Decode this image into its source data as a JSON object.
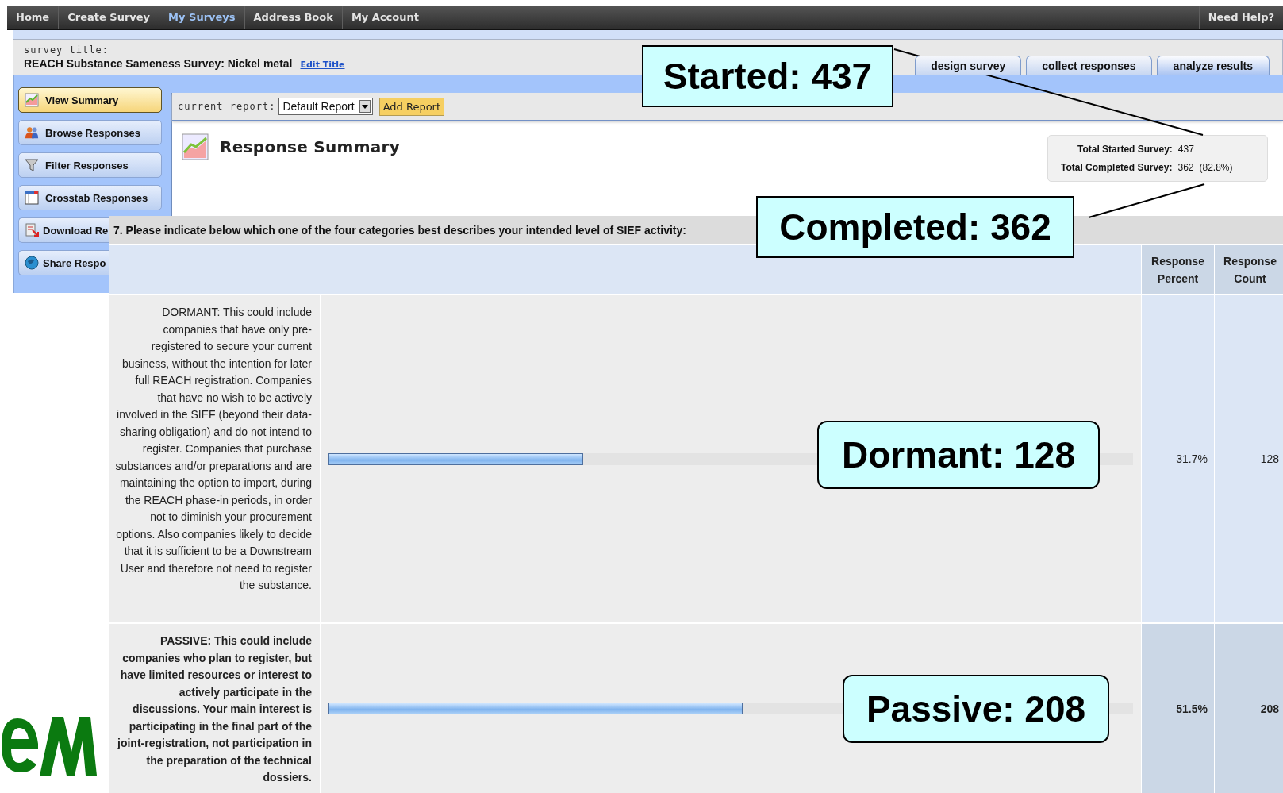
{
  "nav": {
    "items": [
      {
        "label": "Home",
        "selected": false
      },
      {
        "label": "Create Survey",
        "selected": false
      },
      {
        "label": "My Surveys",
        "selected": true
      },
      {
        "label": "Address Book",
        "selected": false
      },
      {
        "label": "My Account",
        "selected": false
      }
    ],
    "help": "Need Help?"
  },
  "survey": {
    "label": "survey title:",
    "title": "REACH Substance Sameness Survey: Nickel metal",
    "edit_link": "Edit Title"
  },
  "tabs": [
    {
      "label": "design survey",
      "selected": false
    },
    {
      "label": "collect responses",
      "selected": false
    },
    {
      "label": "analyze results",
      "selected": true
    }
  ],
  "sidebar": {
    "items": [
      {
        "label": "View Summary",
        "selected": true
      },
      {
        "label": "Browse Responses",
        "selected": false
      },
      {
        "label": "Filter Responses",
        "selected": false
      },
      {
        "label": "Crosstab Responses",
        "selected": false
      },
      {
        "label": "Download Re",
        "selected": false
      },
      {
        "label": "Share Respo",
        "selected": false
      }
    ]
  },
  "report_bar": {
    "label": "current report:",
    "dropdown_value": "Default Report",
    "button": "Add Report"
  },
  "summary": {
    "title": "Response Summary",
    "stats": [
      {
        "label": "Total Started Survey:",
        "value": "437"
      },
      {
        "label": "Total Completed Survey:",
        "value": "362",
        "extra": "(82.8%)"
      }
    ]
  },
  "question": {
    "text": "7. Please indicate below which one of the four categories best describes your intended level of SIEF activity:",
    "columns": [
      "Response Percent",
      "Response Count"
    ],
    "rows": [
      {
        "text": "DORMANT: This could include companies that have only pre-registered to secure your current business, without the intention for later full REACH registration. Companies that have no wish to be actively involved in the SIEF (beyond their data-sharing obligation) and do not intend to register. Companies that purchase substances and/or preparations and are maintaining the option to import, during the REACH phase-in periods, in order not to diminish your procurement options. Also companies likely to decide that it is sufficient to be a Downstream User and therefore not need to register the substance.",
        "level": 0.317,
        "percent": "31.7%",
        "count": "128",
        "highlighted": false
      },
      {
        "text": "PASSIVE: This could include companies who plan to register, but have limited resources or interest to actively participate in the discussions. Your main interest is participating in the final part of the joint-registration, not participation in the preparation of the technical dossiers.",
        "level": 0.515,
        "percent": "51.5%",
        "count": "208",
        "highlighted": true
      }
    ]
  },
  "callouts": [
    {
      "text": "Started: 437",
      "kind": "square"
    },
    {
      "text": "Completed: 362",
      "kind": "square"
    },
    {
      "text": "Dormant: 128",
      "kind": "rounded"
    },
    {
      "text": "Passive: 208",
      "kind": "rounded"
    }
  ]
}
